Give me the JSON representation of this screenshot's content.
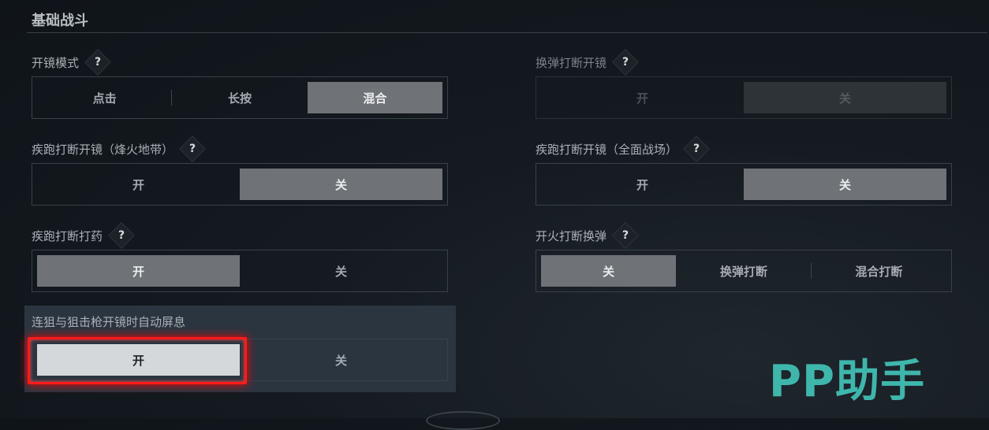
{
  "section": {
    "title": "基础战斗"
  },
  "settings": {
    "scope_mode": {
      "label": "开镜模式",
      "help": "?",
      "options": [
        "点击",
        "长按",
        "混合"
      ],
      "selected": "混合"
    },
    "reload_interrupt_scope": {
      "label": "换弹打断开镜",
      "help": "?",
      "options": [
        "开",
        "关"
      ],
      "selected": "关"
    },
    "sprint_interrupt_scope_warzone": {
      "label": "疾跑打断开镜（烽火地带）",
      "help": "?",
      "options": [
        "开",
        "关"
      ],
      "selected": "关"
    },
    "sprint_interrupt_scope_havoc": {
      "label": "疾跑打断开镜（全面战场）",
      "help": "?",
      "options": [
        "开",
        "关"
      ],
      "selected": "关"
    },
    "sprint_interrupt_heal": {
      "label": "疾跑打断打药",
      "help": "?",
      "options": [
        "开",
        "关"
      ],
      "selected": "开"
    },
    "fire_interrupt_reload": {
      "label": "开火打断换弹",
      "help": "?",
      "options": [
        "关",
        "换弹打断",
        "混合打断"
      ],
      "selected": "关"
    },
    "auto_hold_breath": {
      "label": "连狙与狙击枪开镜时自动屏息",
      "options": [
        "开",
        "关"
      ],
      "selected": "开"
    }
  },
  "watermark": {
    "text": "PP助手"
  },
  "colors": {
    "highlight": "#ff1b1b",
    "accent": "#3fb6ab",
    "selected": "#6f7377"
  }
}
